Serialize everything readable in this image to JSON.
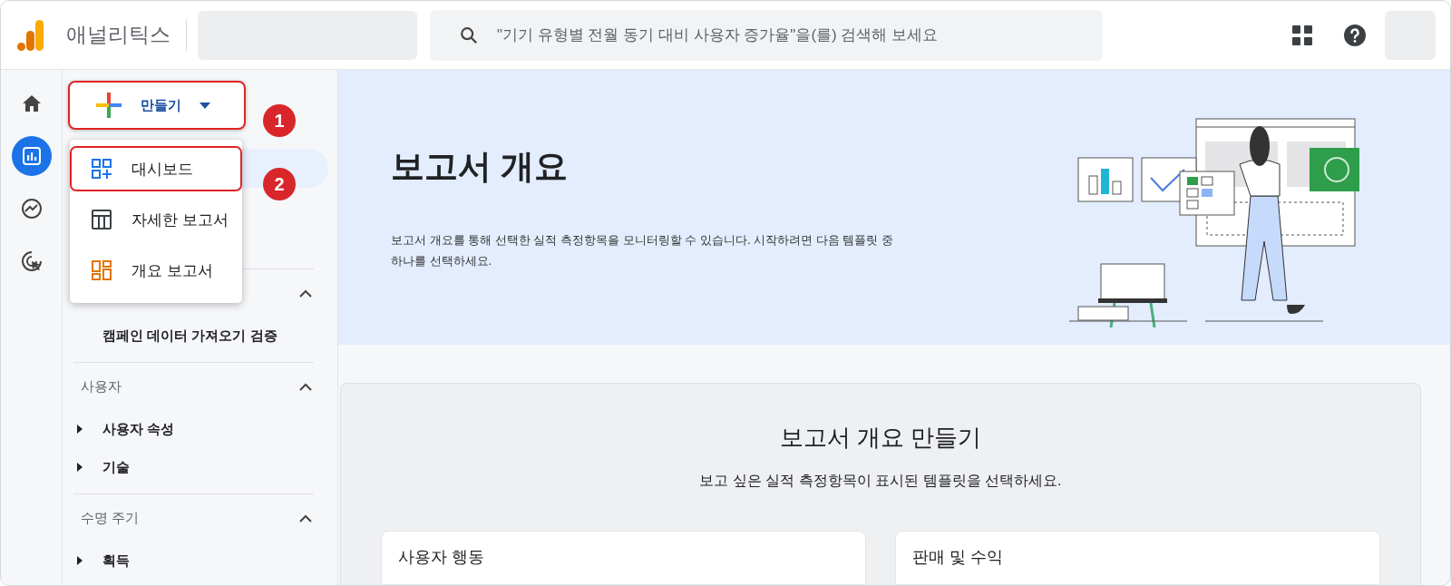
{
  "header": {
    "product_name": "애널리틱스",
    "search": {
      "placeholder": "\"기기 유형별 전월 동기 대비 사용자 증가율\"을(를) 검색해 보세요"
    }
  },
  "nav_rail": [
    {
      "kind": "home",
      "selected": false
    },
    {
      "kind": "reports",
      "selected": true
    },
    {
      "kind": "explore",
      "selected": false
    },
    {
      "kind": "advertising",
      "selected": false
    }
  ],
  "create_button": {
    "label": "만들기",
    "highlighted": true,
    "callout": "1"
  },
  "create_menu": [
    {
      "kind": "dashboard",
      "label": "대시보드",
      "highlighted": true,
      "callout": "2"
    },
    {
      "kind": "detail",
      "label": "자세한 보고서",
      "highlighted": false
    },
    {
      "kind": "overview",
      "label": "개요 보고서",
      "highlighted": false
    }
  ],
  "sidebar": {
    "sections": [
      {
        "expanded": true,
        "items": [
          {
            "label": "캠페인 데이터 가져오기 검증",
            "has_children": false
          }
        ]
      },
      {
        "title": "사용자",
        "expanded": true,
        "items": [
          {
            "label": "사용자 속성",
            "has_children": true
          },
          {
            "label": "기술",
            "has_children": true
          }
        ]
      },
      {
        "title": "수명 주기",
        "expanded": true,
        "items": [
          {
            "label": "획득",
            "has_children": true
          }
        ]
      }
    ]
  },
  "hero": {
    "title": "보고서 개요",
    "description": "보고서 개요를 통해 선택한 실적 측정항목을 모니터링할 수 있습니다. 시작하려면 다음 템플릿 중 하나를 선택하세요."
  },
  "template_panel": {
    "title": "보고서 개요 만들기",
    "subtitle": "보고 싶은 실적 측정항목이 표시된 템플릿을 선택하세요.",
    "templates": [
      {
        "title": "사용자 행동"
      },
      {
        "title": "판매 및 수익"
      }
    ]
  }
}
